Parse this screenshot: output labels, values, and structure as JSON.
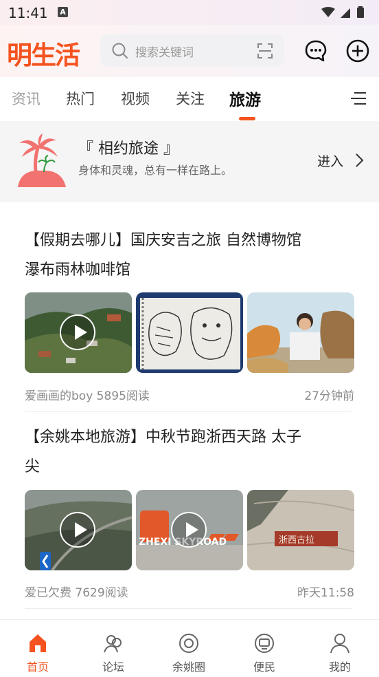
{
  "status": {
    "time": "11:41",
    "a_badge": "A"
  },
  "header": {
    "logo": "明生活",
    "search_placeholder": "搜索关键词"
  },
  "tabs": [
    {
      "label": "资讯",
      "active": false
    },
    {
      "label": "热门",
      "active": false
    },
    {
      "label": "视频",
      "active": false
    },
    {
      "label": "关注",
      "active": false
    },
    {
      "label": "旅游",
      "active": true
    }
  ],
  "banner": {
    "title": "『 相约旅途 』",
    "subtitle": "身体和灵魂，总有一样在路上。",
    "enter": "进入"
  },
  "articles": [
    {
      "title_line1": "【假期去哪儿】国庆安吉之旅 自然博物馆",
      "title_line2": "瀑布雨林咖啡馆",
      "author_reads": "爱画画的boy 5895阅读",
      "time": "27分钟前"
    },
    {
      "title_line1": "【余姚本地旅游】中秋节跑浙西天路 太子",
      "title_line2": "尖",
      "author_reads": "爱已欠费 7629阅读",
      "time": "昨天11:58",
      "image_text_zhexi": "ZHEXI SKYROAD",
      "image_text_stone": "浙西古拉"
    }
  ],
  "tabbar": [
    {
      "label": "首页",
      "icon": "home-icon",
      "active": true
    },
    {
      "label": "论坛",
      "icon": "forum-icon",
      "active": false
    },
    {
      "label": "余姚圈",
      "icon": "circle-icon",
      "active": false
    },
    {
      "label": "便民",
      "icon": "service-icon",
      "active": false
    },
    {
      "label": "我的",
      "icon": "profile-icon",
      "active": false
    }
  ],
  "colors": {
    "accent": "#f4531f",
    "palm": "#f2726f"
  }
}
